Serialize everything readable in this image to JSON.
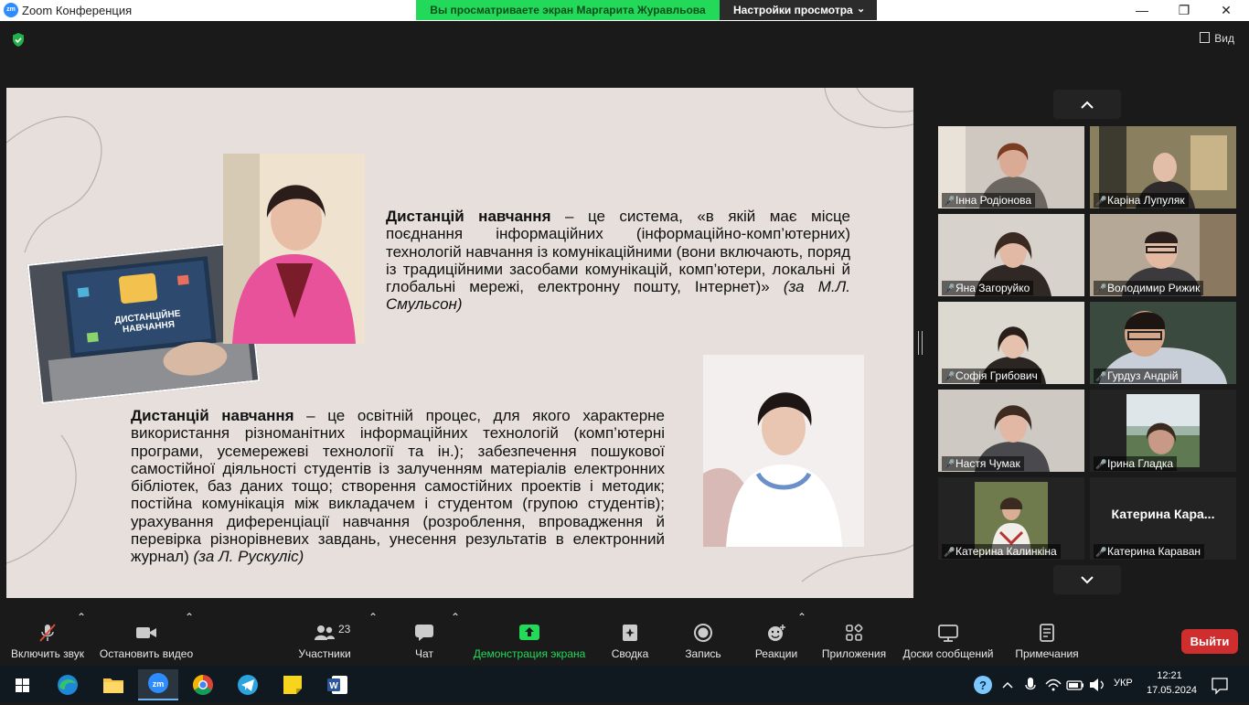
{
  "window": {
    "title": "Zoom Конференция"
  },
  "share_banner": {
    "text": "Вы просматриваете экран Маргарита Журавльова",
    "settings_label": "Настройки просмотра"
  },
  "view_button": "Вид",
  "slide": {
    "p1_term": "Дистанцій навчання",
    "p1_body": " – це система, «в якій має місце поєднання інформаційних (інформаційно-комп’ютерних) технологій навчання із комунікаційними (вони включають, поряд із традиційними засобами комунікацій, комп’ютери, локальні й глобальні мережі, електронну пошту, Інтернет)»",
    "p1_source": " (за М.Л. Смульсон)",
    "p2_term": "Дистанцій навчання",
    "p2_body": " – це освітній процес, для якого характерне використання різноманітних інформаційних технологій (комп’ютерні програми, усемережеві технології та ін.); забезпечення пошукової самостійної діяльності студентів із залученням матеріалів електронних бібліотек, баз даних тощо; створення самостійних проектів і методик; постійна комунікація між викладачем і студентом (групою студентів); урахування диференціації навчання (розроблення, впровадження й перевірка різнорівневих завдань, унесення результатів в електронний журнал)",
    "p2_source": " (за Л. Рускуліс)",
    "laptop_caption": "ДИСТАНЦІЙНЕ НАВЧАННЯ"
  },
  "participants_gallery": [
    {
      "name": "Інна Родіонова",
      "muted": true
    },
    {
      "name": "Каріна Лупуляк",
      "muted": true
    },
    {
      "name": "Яна Загоруйко",
      "muted": true
    },
    {
      "name": "Володимир Рижик",
      "muted": true
    },
    {
      "name": "Софія Грибович",
      "muted": true
    },
    {
      "name": "Гурдуз Андрій",
      "muted": true
    },
    {
      "name": "Настя Чумак",
      "muted": true
    },
    {
      "name": "Ірина Гладка",
      "muted": true
    },
    {
      "name": "Катерина Калинкіна",
      "muted": true
    },
    {
      "name": "Катерина Караван",
      "muted": true,
      "big_label": "Катерина  Кара..."
    }
  ],
  "toolbar": {
    "unmute": "Включить звук",
    "stop_video": "Остановить видео",
    "participants": "Участники",
    "participants_count": "23",
    "chat": "Чат",
    "share_screen": "Демонстрация экрана",
    "summary": "Сводка",
    "record": "Запись",
    "reactions": "Реакции",
    "apps": "Приложения",
    "whiteboards": "Доски сообщений",
    "notes": "Примечания",
    "leave": "Выйти"
  },
  "taskbar": {
    "lang": "УКР",
    "time": "12:21",
    "date": "17.05.2024"
  },
  "colors": {
    "share_green": "#23d959",
    "leave_red": "#cf2e2e",
    "mic_red": "#e0493a",
    "slide_bg": "#e6dfdc"
  }
}
